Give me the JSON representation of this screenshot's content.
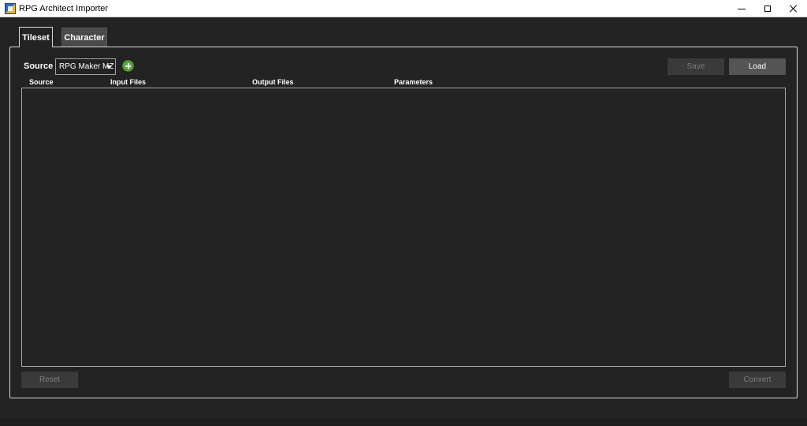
{
  "window": {
    "title": "RPG Architect Importer"
  },
  "tabs": [
    {
      "label": "Tileset",
      "active": true
    },
    {
      "label": "Character",
      "active": false
    }
  ],
  "toolbar": {
    "source_label": "Source",
    "source_value": "RPG Maker MZ",
    "save_label": "Save",
    "load_label": "Load"
  },
  "table": {
    "columns": [
      "Source",
      "Input Files",
      "Output Files",
      "Parameters"
    ],
    "rows": []
  },
  "footer": {
    "reset_label": "Reset",
    "convert_label": "Convert"
  },
  "colors": {
    "background": "#232323",
    "add_icon": "#5aa438",
    "disabled_button": "#3a3a3a",
    "enabled_button": "#555555"
  },
  "icons": {
    "app": "app-icon",
    "add": "plus-circle-icon",
    "dropdown": "chevron-down-icon",
    "minimize": "minimize-icon",
    "maximize": "maximize-icon",
    "close": "close-icon"
  }
}
